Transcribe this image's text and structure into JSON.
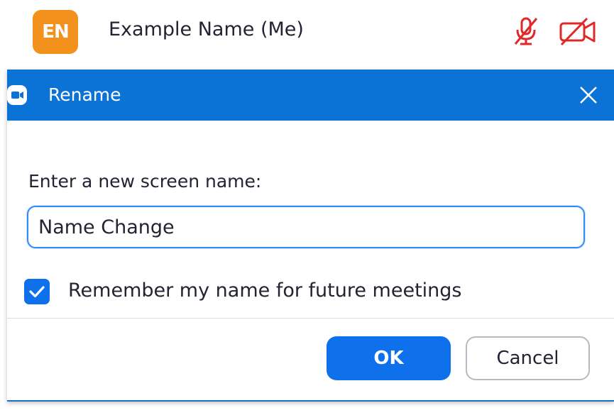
{
  "participant": {
    "avatar_initials": "EN",
    "avatar_color": "#f2921d",
    "name": "Example Name (Me)",
    "status_icons": [
      "microphone-muted-icon",
      "video-off-icon"
    ],
    "status_color": "#e02828"
  },
  "dialog": {
    "app_icon": "zoom-camera-icon",
    "title": "Rename",
    "title_bar_color": "#0b72d6",
    "close_icon": "close-icon",
    "prompt_label": "Enter a new screen name:",
    "name_input_value": "Name Change",
    "remember_checkbox": {
      "label": "Remember my name for future meetings",
      "checked": true
    },
    "ok_label": "OK",
    "cancel_label": "Cancel",
    "accent_color": "#0e71eb"
  }
}
